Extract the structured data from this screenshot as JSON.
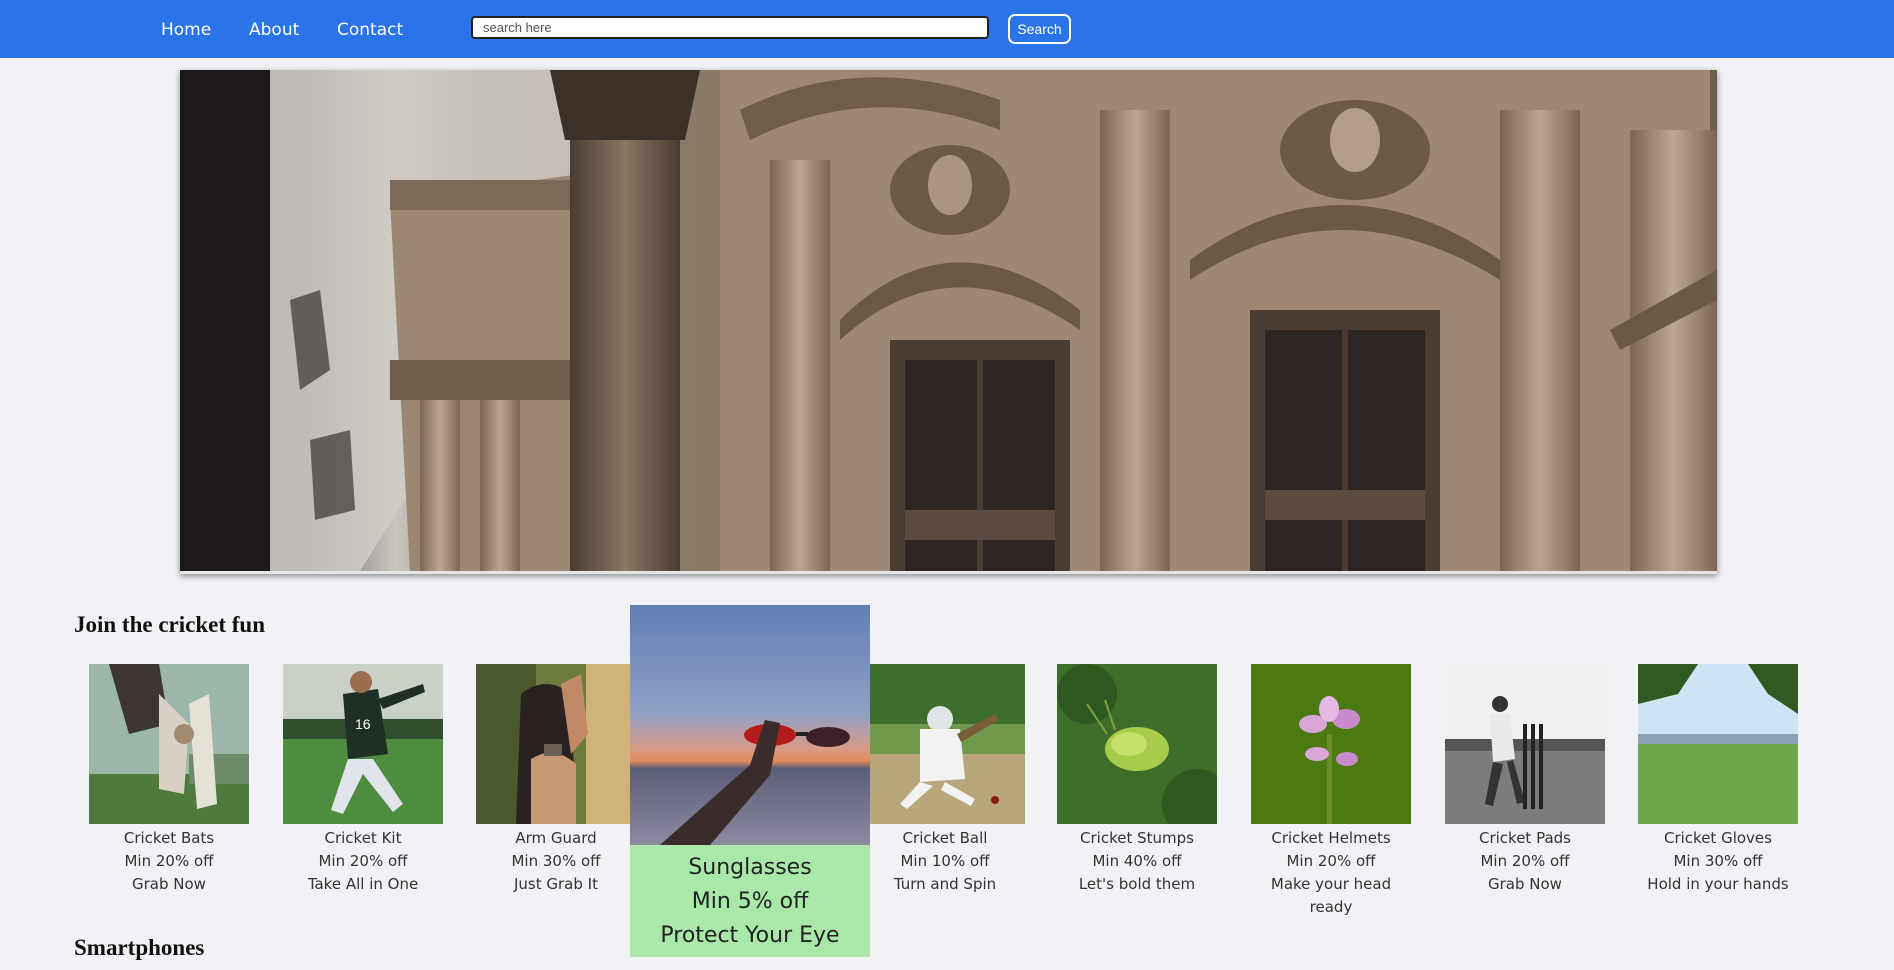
{
  "nav": {
    "links": [
      "Home",
      "About",
      "Contact"
    ],
    "search_placeholder": "search here",
    "search_button": "Search"
  },
  "hero": {
    "image": "ornate-building-facade"
  },
  "sections": {
    "cricket_title": "Join the cricket fun",
    "smartphones_title": "Smartphones"
  },
  "products": [
    {
      "name": "Cricket Bats",
      "offer": "Min 20% off",
      "tagline": "Grab Now",
      "image": "batsman-photo"
    },
    {
      "name": "Cricket Kit",
      "offer": "Min 20% off",
      "tagline": "Take All in One",
      "image": "football-player-photo"
    },
    {
      "name": "Arm Guard",
      "offer": "Min 30% off",
      "tagline": "Just Grab It",
      "image": "woman-arm-photo"
    },
    {
      "name": "Cricket Ball",
      "offer": "Min 10% off",
      "tagline": "Turn and Spin",
      "image": "cricket-batting-photo"
    },
    {
      "name": "Cricket Stumps",
      "offer": "Min 40% off",
      "tagline": "Let's bold them",
      "image": "green-bug-photo"
    },
    {
      "name": "Cricket Helmets",
      "offer": "Min 20% off",
      "tagline": "Make your head ready",
      "image": "pink-flower-photo"
    },
    {
      "name": "Cricket Pads",
      "offer": "Min 20% off",
      "tagline": "Grab Now",
      "image": "bw-cricket-photo"
    },
    {
      "name": "Cricket Gloves",
      "offer": "Min 30% off",
      "tagline": "Hold in your hands",
      "image": "green-field-photo"
    }
  ],
  "highlight": {
    "name": "Sunglasses",
    "offer": "Min 5% off",
    "tagline": "Protect Your Eye",
    "image": "sunglasses-sunset-photo",
    "bg": "#a9e8a9"
  },
  "colors": {
    "nav": "#2a73e8",
    "page_bg": "#f0f2f5"
  }
}
